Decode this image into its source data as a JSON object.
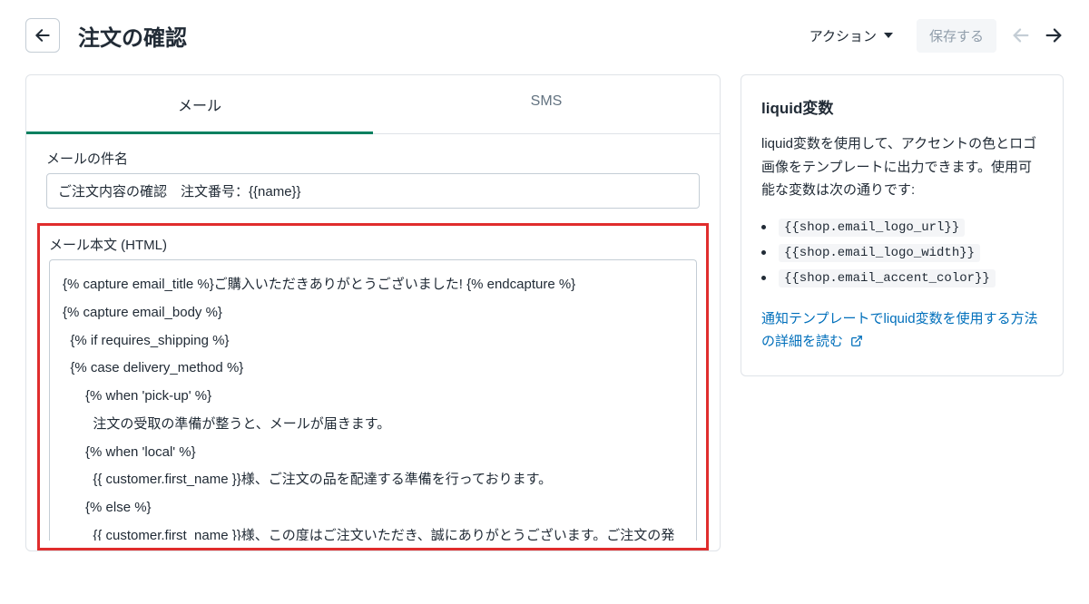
{
  "header": {
    "title": "注文の確認",
    "action_label": "アクション",
    "save_label": "保存する"
  },
  "tabs": [
    {
      "label": "メール",
      "active": true
    },
    {
      "label": "SMS",
      "active": false
    }
  ],
  "subject": {
    "label": "メールの件名",
    "value": "ご注文内容の確認　注文番号：{{name}}"
  },
  "body": {
    "label": "メール本文 (HTML)",
    "code": "{% capture email_title %}ご購入いただきありがとうございました! {% endcapture %}\n{% capture email_body %}\n  {% if requires_shipping %}\n  {% case delivery_method %}\n      {% when 'pick-up' %}\n        注文の受取の準備が整うと、メールが届きます。\n      {% when 'local' %}\n        {{ customer.first_name }}様、ご注文の品を配達する準備を行っております。\n      {% else %}\n        {{ customer.first_name }}様、この度はご注文いただき、誠にありがとうございます。ご注文の発送準備を行なっております。商品の発送はあらためてご案内します。"
  },
  "sidebar": {
    "title": "liquid変数",
    "description": "liquid変数を使用して、アクセントの色とロゴ画像をテンプレートに出力できます。使用可能な変数は次の通りです:",
    "variables": [
      "{{shop.email_logo_url}}",
      "{{shop.email_logo_width}}",
      "{{shop.email_accent_color}}"
    ],
    "link_text": "通知テンプレートでliquid変数を使用する方法の詳細を読む"
  }
}
